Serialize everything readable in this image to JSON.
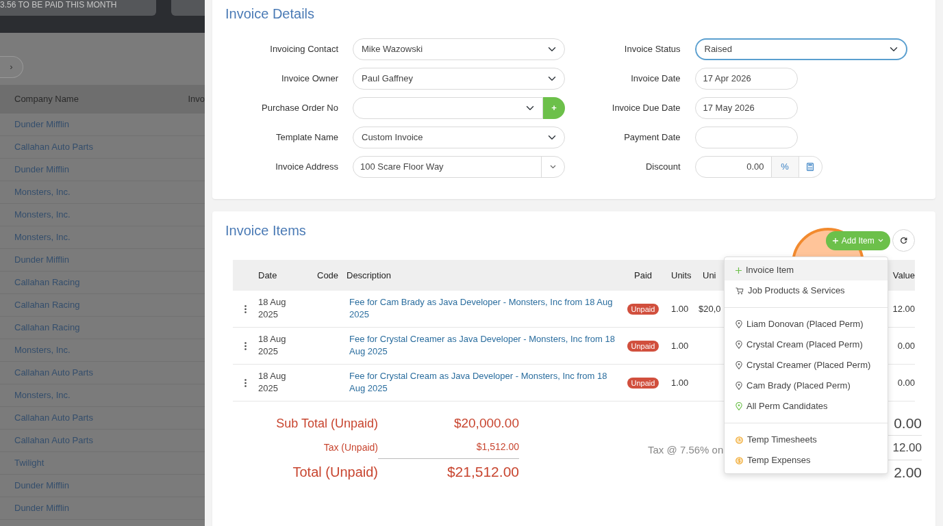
{
  "background_page": {
    "summary_card": "3.56 TO BE PAID THIS MONTH",
    "pager_next": "›",
    "columns": [
      "Company Name",
      "Invo"
    ],
    "companies": [
      "Dunder Mifflin",
      "Callahan Auto Parts",
      "Dunder Mifflin",
      "Monsters, Inc.",
      "Monsters, Inc.",
      "Monsters, Inc.",
      "Dunder Mifflin",
      "Callahan Racing",
      "Callahan Racing",
      "Callahan Racing",
      "Monsters, Inc.",
      "Callahan Auto Parts",
      "Monsters, Inc.",
      "Callahan Auto Parts",
      "Callahan Auto Parts",
      "Twilight",
      "Dunder Mifflin",
      "Dunder Mifflin"
    ]
  },
  "invoice_details": {
    "title": "Invoice Details",
    "left_fields": [
      {
        "label": "Invoicing Contact",
        "value": "Mike Wazowski",
        "kind": "select"
      },
      {
        "label": "Invoice Owner",
        "value": "Paul Gaffney",
        "kind": "select"
      },
      {
        "label": "Purchase Order No",
        "kind": "select_add",
        "button": "+"
      },
      {
        "label": "Template Name",
        "value": "Custom Invoice",
        "kind": "select"
      },
      {
        "label": "Invoice Address",
        "value": "100 Scare Floor Way",
        "kind": "combo"
      }
    ],
    "right_fields": [
      {
        "label": "Invoice Status",
        "value": "Raised",
        "kind": "select",
        "focused": true
      },
      {
        "label": "Invoice Date",
        "value": "17 Apr 2026",
        "kind": "date"
      },
      {
        "label": "Invoice Due Date",
        "value": "17 May 2026",
        "kind": "date"
      },
      {
        "label": "Payment Date",
        "kind": "date"
      },
      {
        "label": "Discount",
        "value": "0.00",
        "unit": "%",
        "kind": "discount"
      }
    ]
  },
  "invoice_items": {
    "title": "Invoice Items",
    "add_button": "Add Item",
    "columns": [
      "Date",
      "Code",
      "Description",
      "Paid",
      "Units",
      "Uni",
      "Value"
    ],
    "rows": [
      {
        "date": "18 Aug 2025",
        "description": "Fee for Cam Brady as Java Developer - Monsters, Inc from 18 Aug 2025",
        "paid": "Unpaid",
        "units": "1.00",
        "unit_price": "$20,0",
        "value": "12.00"
      },
      {
        "date": "18 Aug 2025",
        "description": "Fee for Crystal Creamer as Java Developer - Monsters, Inc from 18 Aug 2025",
        "paid": "Unpaid",
        "units": "1.00",
        "value": "0.00"
      },
      {
        "date": "18 Aug 2025",
        "description": "Fee for Crystal Cream as Java Developer - Monsters, Inc from 18 Aug 2025",
        "paid": "Unpaid",
        "units": "1.00",
        "value": "0.00"
      }
    ],
    "totals_left": [
      {
        "label": "Sub Total (Unpaid)",
        "value": "$20,000.00",
        "kind": "sub"
      },
      {
        "label": "Tax (Unpaid)",
        "value": "$1,512.00",
        "kind": "tax"
      },
      {
        "label": "Total (Unpaid)",
        "value": "$21,512.00",
        "kind": "total"
      }
    ],
    "totals_right": {
      "tax_note": "Tax @ 7.56% on",
      "values": [
        "0.00",
        "12.00",
        "2.00"
      ]
    },
    "menu": [
      [
        {
          "label": "Invoice Item",
          "kind": "plus",
          "selected": true
        },
        {
          "label": "Job Products & Services",
          "kind": "cart",
          "selected": false
        }
      ],
      [
        {
          "label": "Liam Donovan (Placed Perm)",
          "kind": "pin",
          "selected": false
        },
        {
          "label": "Crystal Cream (Placed Perm)",
          "kind": "pin",
          "selected": false
        },
        {
          "label": "Crystal Creamer (Placed Perm)",
          "kind": "pin",
          "selected": false
        },
        {
          "label": "Cam Brady (Placed Perm)",
          "kind": "pin",
          "selected": false
        },
        {
          "label": "All Perm Candidates",
          "kind": "pin_all",
          "selected": false
        }
      ],
      [
        {
          "label": "Temp Timesheets",
          "kind": "clock",
          "selected": false
        },
        {
          "label": "Temp Expenses",
          "kind": "dollar",
          "selected": false
        }
      ]
    ]
  }
}
